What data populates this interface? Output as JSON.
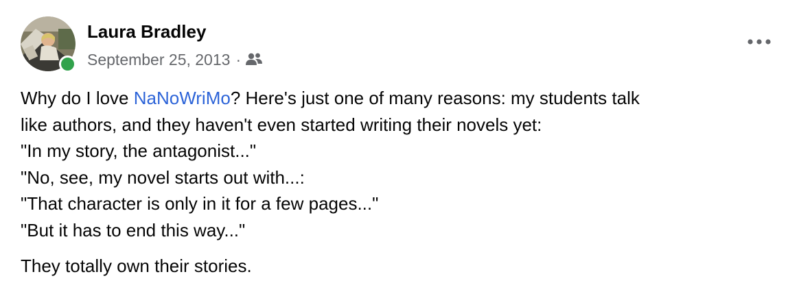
{
  "post": {
    "author": "Laura Bradley",
    "date": "September 25, 2013",
    "separator": "·",
    "audience_icon": "friends-icon",
    "online_status_color": "#31a24c",
    "link_color": "#2d64d8",
    "body": {
      "line1_before": "Why do I love ",
      "line1_link": "NaNoWriMo",
      "line1_after": "?  Here's just one of many reasons:  my students talk",
      "line2": "like authors, and they haven't even started writing their novels yet:",
      "line3": "\"In my story, the antagonist...\"",
      "line4": "\"No, see, my novel starts out with...:",
      "line5": "\"That character is only in it for a few pages...\"",
      "line6": "\"But it has to end this way...\"",
      "closing": "They totally own their stories."
    }
  }
}
